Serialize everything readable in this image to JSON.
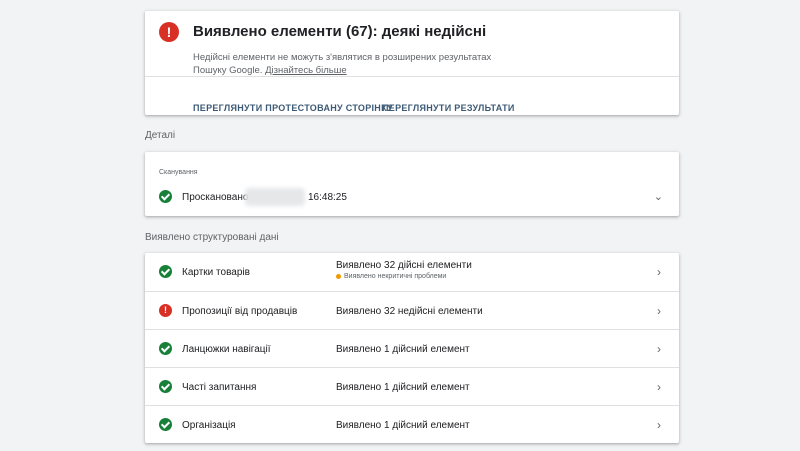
{
  "header": {
    "title": "Виявлено елементи (67): деякі недійсні",
    "description": "Недійсні елементи не можуть з'являтися в розширених результатах Пошуку Google. ",
    "learn_more": "Дізнайтесь більше",
    "action_tested_page": "ПЕРЕГЛЯНУТИ ПРОТЕСТОВАНУ СТОРІНКУ",
    "action_results": "ПЕРЕГЛЯНУТИ РЕЗУЛЬТАТИ",
    "icon": "error-icon"
  },
  "details": {
    "section_label": "Деталі",
    "crawl_label": "Сканування",
    "crawled_text": "Проскановано",
    "time": "16:48:25"
  },
  "structured": {
    "section_label": "Виявлено структуровані дані",
    "rows": [
      {
        "name": "Картки товарів",
        "status": "Виявлено 32 дійсні елементи",
        "sub": "Виявлено некритичні проблеми",
        "icon": "check-icon"
      },
      {
        "name": "Пропозиції від продавців",
        "status": "Виявлено 32 недійсні елементи",
        "icon": "error-icon"
      },
      {
        "name": "Ланцюжки навігації",
        "status": "Виявлено 1 дійсний елемент",
        "icon": "check-icon"
      },
      {
        "name": "Часті запитання",
        "status": "Виявлено 1 дійсний елемент",
        "icon": "check-icon"
      },
      {
        "name": "Організація",
        "status": "Виявлено 1 дійсний елемент",
        "icon": "check-icon"
      }
    ]
  },
  "colors": {
    "error": "#d93025",
    "success": "#188038",
    "warning": "#f29900",
    "action": "#3c5a76"
  }
}
